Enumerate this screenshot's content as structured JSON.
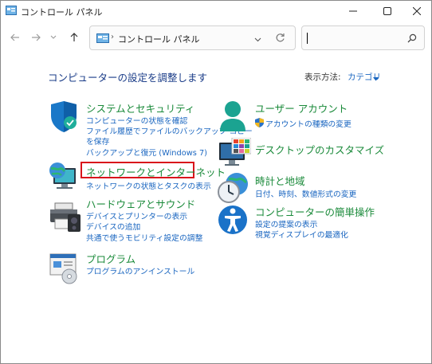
{
  "window": {
    "title": "コントロール パネル",
    "minimize_icon": "minimize-icon",
    "maximize_icon": "maximize-icon",
    "close_icon": "close-icon"
  },
  "navbar": {
    "back_icon": "back-arrow-icon",
    "forward_icon": "forward-arrow-icon",
    "recent_icon": "chevron-down-icon",
    "up_icon": "up-arrow-icon",
    "address_path": "コントロール パネル",
    "address_separator": "›",
    "search_placeholder": ""
  },
  "header": {
    "heading": "コンピューターの設定を調整します",
    "view_by_label": "表示方法:",
    "view_by_value": "カテゴリ"
  },
  "categories": [
    {
      "title": "システムとセキュリティ",
      "links": [
        "コンピューターの状態を確認",
        "ファイル履歴でファイルのバックアップ コピー",
        "を保存",
        "バックアップと復元 (Windows 7)"
      ]
    },
    {
      "title": "ネットワークとインターネット",
      "links": [
        "ネットワークの状態とタスクの表示"
      ]
    },
    {
      "title": "ハードウェアとサウンド",
      "links": [
        "デバイスとプリンターの表示",
        "デバイスの追加",
        "共通で使うモビリティ設定の調整"
      ]
    },
    {
      "title": "プログラム",
      "links": [
        "プログラムのアンインストール"
      ]
    },
    {
      "title": "ユーザー アカウント",
      "links": [
        "アカウントの種類の変更"
      ]
    },
    {
      "title": "デスクトップのカスタマイズ",
      "links": []
    },
    {
      "title": "時計と地域",
      "links": [
        "日付、時刻、数値形式の変更"
      ]
    },
    {
      "title": "コンピューターの簡単操作",
      "links": [
        "設定の提案の表示",
        "視覚ディスプレイの最適化"
      ]
    }
  ],
  "colors": {
    "category_title": "#1a8a3a",
    "link": "#1a66c0",
    "heading": "#1a3c88",
    "highlight_border": "#d9141b"
  }
}
